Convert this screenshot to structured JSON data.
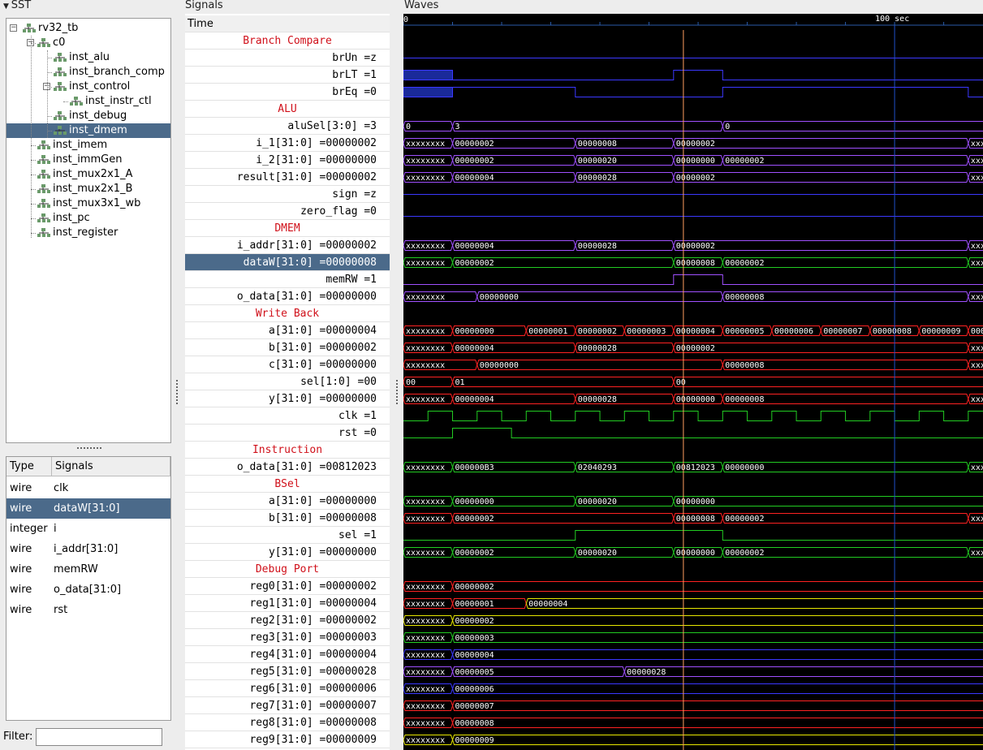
{
  "panels": {
    "sst_title": "SST",
    "signals_title": "Signals",
    "waves_title": "Waves"
  },
  "tree": [
    {
      "label": "rv32_tb",
      "depth": 0,
      "expander": "−"
    },
    {
      "label": "c0",
      "depth": 1,
      "expander": "−"
    },
    {
      "label": "inst_alu",
      "depth": 2
    },
    {
      "label": "inst_branch_comp",
      "depth": 2
    },
    {
      "label": "inst_control",
      "depth": 2,
      "expander": "−"
    },
    {
      "label": "inst_instr_ctl",
      "depth": 3
    },
    {
      "label": "inst_debug",
      "depth": 2
    },
    {
      "label": "inst_dmem",
      "depth": 2,
      "selected": true
    },
    {
      "label": "inst_imem",
      "depth": 1
    },
    {
      "label": "inst_immGen",
      "depth": 1
    },
    {
      "label": "inst_mux2x1_A",
      "depth": 1
    },
    {
      "label": "inst_mux2x1_B",
      "depth": 1
    },
    {
      "label": "inst_mux3x1_wb",
      "depth": 1
    },
    {
      "label": "inst_pc",
      "depth": 1
    },
    {
      "label": "inst_register",
      "depth": 1
    }
  ],
  "sig_table": {
    "col_type": "Type",
    "col_signals": "Signals",
    "rows": [
      {
        "type": "wire",
        "name": "clk"
      },
      {
        "type": "wire",
        "name": "dataW[31:0]",
        "selected": true
      },
      {
        "type": "integer",
        "name": "i"
      },
      {
        "type": "wire",
        "name": "i_addr[31:0]"
      },
      {
        "type": "wire",
        "name": "memRW"
      },
      {
        "type": "wire",
        "name": "o_data[31:0]"
      },
      {
        "type": "wire",
        "name": "rst"
      }
    ]
  },
  "filter_label": "Filter:",
  "filter_value": "",
  "time_label": "Time",
  "timescale_label": "100 sec",
  "signals": [
    {
      "kind": "group",
      "label": "Branch Compare"
    },
    {
      "label": "brUn =z"
    },
    {
      "label": "brLT =1"
    },
    {
      "label": "brEq =0"
    },
    {
      "kind": "group",
      "label": "ALU"
    },
    {
      "label": "aluSel[3:0] =3"
    },
    {
      "label": "i_1[31:0] =00000002"
    },
    {
      "label": "i_2[31:0] =00000000"
    },
    {
      "label": "result[31:0] =00000002"
    },
    {
      "label": "sign =z"
    },
    {
      "label": "zero_flag =0"
    },
    {
      "kind": "group",
      "label": "DMEM"
    },
    {
      "label": "i_addr[31:0] =00000002"
    },
    {
      "label": "dataW[31:0] =00000008",
      "selected": true
    },
    {
      "label": "memRW =1"
    },
    {
      "label": "o_data[31:0] =00000000"
    },
    {
      "kind": "group",
      "label": "Write Back"
    },
    {
      "label": "a[31:0] =00000004"
    },
    {
      "label": "b[31:0] =00000002"
    },
    {
      "label": "c[31:0] =00000000"
    },
    {
      "label": "sel[1:0] =00"
    },
    {
      "label": "y[31:0] =00000000"
    },
    {
      "label": "clk =1"
    },
    {
      "label": "rst =0"
    },
    {
      "kind": "group",
      "label": "Instruction"
    },
    {
      "label": "o_data[31:0] =00812023"
    },
    {
      "kind": "group",
      "label": "BSel"
    },
    {
      "label": "a[31:0] =00000000"
    },
    {
      "label": "b[31:0] =00000008"
    },
    {
      "label": "sel =1"
    },
    {
      "label": "y[31:0] =00000000"
    },
    {
      "kind": "group",
      "label": "Debug Port"
    },
    {
      "label": "reg0[31:0] =00000002"
    },
    {
      "label": "reg1[31:0] =00000004"
    },
    {
      "label": "reg2[31:0] =00000002"
    },
    {
      "label": "reg3[31:0] =00000003"
    },
    {
      "label": "reg4[31:0] =00000004"
    },
    {
      "label": "reg5[31:0] =00000028"
    },
    {
      "label": "reg6[31:0] =00000006"
    },
    {
      "label": "reg7[31:0] =00000007"
    },
    {
      "label": "reg8[31:0] =00000008"
    },
    {
      "label": "reg9[31:0] =00000009"
    }
  ],
  "colors": {
    "blue": "#3b38ff",
    "red": "#ff2222",
    "purple": "#a050ff",
    "green": "#22cc22",
    "yellow": "#e8e800",
    "cursor": "#ffa060",
    "marker": "#2050c8"
  },
  "waves": {
    "time_unit_note": "times in simulation units; visible window 0 to 118",
    "visible_start": 0,
    "visible_end": 118,
    "cursor_time": 57,
    "marker_time": 100,
    "rows": [
      null,
      {
        "type": "bit",
        "color": "blue",
        "level": "z"
      },
      {
        "type": "bit",
        "color": "blue",
        "init_x_until": 10,
        "edges": [
          [
            10,
            0
          ],
          [
            55,
            1
          ],
          [
            65,
            0
          ]
        ]
      },
      {
        "type": "bit",
        "color": "blue",
        "init_x_until": 10,
        "edges": [
          [
            10,
            1
          ],
          [
            35,
            0
          ],
          [
            65,
            1
          ],
          [
            115,
            0
          ]
        ]
      },
      null,
      {
        "type": "bus",
        "color": "purple",
        "segs": [
          [
            0,
            10,
            "0"
          ],
          [
            10,
            65,
            "3"
          ],
          [
            65,
            120,
            "0"
          ]
        ]
      },
      {
        "type": "bus",
        "color": "purple",
        "segs": [
          [
            0,
            10,
            "xxxxxxxx"
          ],
          [
            10,
            35,
            "00000002"
          ],
          [
            35,
            55,
            "00000008"
          ],
          [
            55,
            115,
            "00000002"
          ],
          [
            115,
            120,
            "xxx"
          ]
        ]
      },
      {
        "type": "bus",
        "color": "purple",
        "segs": [
          [
            0,
            10,
            "xxxxxxxx"
          ],
          [
            10,
            35,
            "00000002"
          ],
          [
            35,
            55,
            "00000020"
          ],
          [
            55,
            65,
            "00000000"
          ],
          [
            65,
            115,
            "00000002"
          ],
          [
            115,
            120,
            "xxx"
          ]
        ]
      },
      {
        "type": "bus",
        "color": "purple",
        "segs": [
          [
            0,
            10,
            "xxxxxxxx"
          ],
          [
            10,
            35,
            "00000004"
          ],
          [
            35,
            55,
            "00000028"
          ],
          [
            55,
            115,
            "00000002"
          ],
          [
            115,
            120,
            "xxx"
          ]
        ]
      },
      {
        "type": "bit",
        "color": "blue",
        "level": "z"
      },
      {
        "type": "bit",
        "color": "blue",
        "edges": [
          [
            0,
            0
          ]
        ]
      },
      null,
      {
        "type": "bus",
        "color": "purple",
        "segs": [
          [
            0,
            10,
            "xxxxxxxx"
          ],
          [
            10,
            35,
            "00000004"
          ],
          [
            35,
            55,
            "00000028"
          ],
          [
            55,
            115,
            "00000002"
          ],
          [
            115,
            120,
            "xxx"
          ]
        ]
      },
      {
        "type": "bus",
        "color": "green",
        "segs": [
          [
            0,
            10,
            "xxxxxxxx"
          ],
          [
            10,
            55,
            "00000002"
          ],
          [
            55,
            65,
            "00000008"
          ],
          [
            65,
            115,
            "00000002"
          ],
          [
            115,
            120,
            "xxx"
          ]
        ]
      },
      {
        "type": "bit",
        "color": "purple",
        "edges": [
          [
            0,
            0
          ],
          [
            55,
            1
          ],
          [
            65,
            0
          ]
        ]
      },
      {
        "type": "bus",
        "color": "purple",
        "segs": [
          [
            0,
            15,
            "xxxxxxxx"
          ],
          [
            15,
            65,
            "00000000"
          ],
          [
            65,
            115,
            "00000008"
          ],
          [
            115,
            120,
            "xxx"
          ]
        ]
      },
      null,
      {
        "type": "bus",
        "color": "red",
        "segs": [
          [
            0,
            10,
            "xxxxxxxx"
          ],
          [
            10,
            25,
            "00000000"
          ],
          [
            25,
            35,
            "00000001"
          ],
          [
            35,
            45,
            "00000002"
          ],
          [
            45,
            55,
            "00000003"
          ],
          [
            55,
            65,
            "00000004"
          ],
          [
            65,
            75,
            "00000005"
          ],
          [
            75,
            85,
            "00000006"
          ],
          [
            85,
            95,
            "00000007"
          ],
          [
            95,
            105,
            "00000008"
          ],
          [
            105,
            115,
            "00000009"
          ],
          [
            115,
            120,
            "000"
          ]
        ]
      },
      {
        "type": "bus",
        "color": "red",
        "segs": [
          [
            0,
            10,
            "xxxxxxxx"
          ],
          [
            10,
            35,
            "00000004"
          ],
          [
            35,
            55,
            "00000028"
          ],
          [
            55,
            115,
            "00000002"
          ],
          [
            115,
            120,
            "xxx"
          ]
        ]
      },
      {
        "type": "bus",
        "color": "red",
        "segs": [
          [
            0,
            15,
            "xxxxxxxx"
          ],
          [
            15,
            65,
            "00000000"
          ],
          [
            65,
            115,
            "00000008"
          ],
          [
            115,
            120,
            "xxx"
          ]
        ]
      },
      {
        "type": "bus",
        "color": "red",
        "segs": [
          [
            0,
            10,
            "00"
          ],
          [
            10,
            55,
            "01"
          ],
          [
            55,
            120,
            "00"
          ]
        ]
      },
      {
        "type": "bus",
        "color": "red",
        "segs": [
          [
            0,
            10,
            "xxxxxxxx"
          ],
          [
            10,
            35,
            "00000004"
          ],
          [
            35,
            55,
            "00000028"
          ],
          [
            55,
            65,
            "00000000"
          ],
          [
            65,
            115,
            "00000008"
          ],
          [
            115,
            120,
            "xxx"
          ]
        ]
      },
      {
        "type": "clock",
        "color": "green",
        "period": 10,
        "first_rise": 5
      },
      {
        "type": "bit",
        "color": "green",
        "edges": [
          [
            0,
            0
          ],
          [
            10,
            1
          ],
          [
            22,
            0
          ]
        ]
      },
      null,
      {
        "type": "bus",
        "color": "green",
        "segs": [
          [
            0,
            10,
            "xxxxxxxx"
          ],
          [
            10,
            35,
            "000000B3"
          ],
          [
            35,
            55,
            "02040293"
          ],
          [
            55,
            65,
            "00812023"
          ],
          [
            65,
            115,
            "00000000"
          ],
          [
            115,
            120,
            "xxx"
          ]
        ]
      },
      null,
      {
        "type": "bus",
        "color": "green",
        "segs": [
          [
            0,
            10,
            "xxxxxxxx"
          ],
          [
            10,
            35,
            "00000000"
          ],
          [
            35,
            55,
            "00000020"
          ],
          [
            55,
            120,
            "00000000"
          ]
        ]
      },
      {
        "type": "bus",
        "color": "red",
        "segs": [
          [
            0,
            10,
            "xxxxxxxx"
          ],
          [
            10,
            55,
            "00000002"
          ],
          [
            55,
            65,
            "00000008"
          ],
          [
            65,
            115,
            "00000002"
          ],
          [
            115,
            120,
            "xxx"
          ]
        ]
      },
      {
        "type": "bit",
        "color": "green",
        "edges": [
          [
            0,
            0
          ],
          [
            35,
            1
          ],
          [
            65,
            0
          ]
        ]
      },
      {
        "type": "bus",
        "color": "green",
        "segs": [
          [
            0,
            10,
            "xxxxxxxx"
          ],
          [
            10,
            35,
            "00000002"
          ],
          [
            35,
            55,
            "00000020"
          ],
          [
            55,
            65,
            "00000000"
          ],
          [
            65,
            115,
            "00000002"
          ],
          [
            115,
            120,
            "xxx"
          ]
        ]
      },
      null,
      {
        "type": "bus",
        "color": "red",
        "segs": [
          [
            0,
            10,
            "xxxxxxxx"
          ],
          [
            10,
            120,
            "00000002"
          ]
        ]
      },
      {
        "type": "bus",
        "color": "red",
        "segs": [
          [
            0,
            10,
            "xxxxxxxx"
          ],
          [
            10,
            25,
            "00000001"
          ],
          [
            25,
            120,
            "00000004"
          ]
        ],
        "tail_color": "yellow"
      },
      {
        "type": "bus",
        "color": "yellow",
        "segs": [
          [
            0,
            10,
            "xxxxxxxx"
          ],
          [
            10,
            120,
            "00000002"
          ]
        ]
      },
      {
        "type": "bus",
        "color": "green",
        "segs": [
          [
            0,
            10,
            "xxxxxxxx"
          ],
          [
            10,
            120,
            "00000003"
          ]
        ]
      },
      {
        "type": "bus",
        "color": "blue",
        "segs": [
          [
            0,
            10,
            "xxxxxxxx"
          ],
          [
            10,
            120,
            "00000004"
          ]
        ]
      },
      {
        "type": "bus",
        "color": "purple",
        "segs": [
          [
            0,
            10,
            "xxxxxxxx"
          ],
          [
            10,
            45,
            "00000005"
          ],
          [
            45,
            120,
            "00000028"
          ]
        ]
      },
      {
        "type": "bus",
        "color": "blue",
        "segs": [
          [
            0,
            10,
            "xxxxxxxx"
          ],
          [
            10,
            120,
            "00000006"
          ]
        ]
      },
      {
        "type": "bus",
        "color": "red",
        "segs": [
          [
            0,
            10,
            "xxxxxxxx"
          ],
          [
            10,
            120,
            "00000007"
          ]
        ]
      },
      {
        "type": "bus",
        "color": "red",
        "segs": [
          [
            0,
            10,
            "xxxxxxxx"
          ],
          [
            10,
            120,
            "00000008"
          ]
        ]
      },
      {
        "type": "bus",
        "color": "yellow",
        "segs": [
          [
            0,
            10,
            "xxxxxxxx"
          ],
          [
            10,
            120,
            "00000009"
          ]
        ]
      }
    ]
  }
}
